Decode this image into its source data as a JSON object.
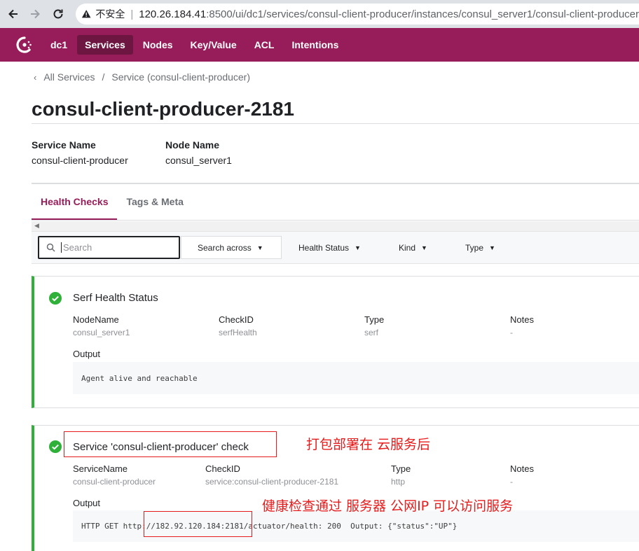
{
  "browser": {
    "insecure_label": "不安全",
    "url_host": "120.26.184.41",
    "url_rest": ":8500/ui/dc1/services/consul-client-producer/instances/consul_server1/consul-client-producer"
  },
  "header": {
    "datacenter": "dc1",
    "nav": [
      "Services",
      "Nodes",
      "Key/Value",
      "ACL",
      "Intentions"
    ],
    "active_nav": "Services",
    "brand_color": "#961d59"
  },
  "breadcrumb": {
    "all_services": "All Services",
    "separator": "/",
    "service": "Service (consul-client-producer)"
  },
  "page_title": "consul-client-producer-2181",
  "meta": {
    "service_name_label": "Service Name",
    "service_name_value": "consul-client-producer",
    "node_name_label": "Node Name",
    "node_name_value": "consul_server1"
  },
  "tabs": [
    "Health Checks",
    "Tags & Meta"
  ],
  "filters": {
    "search_placeholder": "Search",
    "search_across": "Search across",
    "health_status": "Health Status",
    "kind": "Kind",
    "type": "Type"
  },
  "checks": [
    {
      "title": "Serf Health Status",
      "status_color": "#2eb039",
      "fields": [
        {
          "label": "NodeName",
          "value": "consul_server1"
        },
        {
          "label": "CheckID",
          "value": "serfHealth"
        },
        {
          "label": "Type",
          "value": "serf"
        },
        {
          "label": "Notes",
          "value": "-"
        }
      ],
      "output_label": "Output",
      "output": "Agent alive and reachable"
    },
    {
      "title": "Service 'consul-client-producer' check",
      "status_color": "#2eb039",
      "fields": [
        {
          "label": "ServiceName",
          "value": "consul-client-producer"
        },
        {
          "label": "CheckID",
          "value": "service:consul-client-producer-2181"
        },
        {
          "label": "Type",
          "value": "http"
        },
        {
          "label": "Notes",
          "value": "-"
        }
      ],
      "output_label": "Output",
      "output": "HTTP GET http://182.92.120.184:2181/actuator/health: 200  Output: {\"status\":\"UP\"}"
    }
  ],
  "annotations": {
    "deployed": "打包部署在 云服务后",
    "health_passed": "健康检查通过 服务器 公网IP 可以访问服务"
  }
}
